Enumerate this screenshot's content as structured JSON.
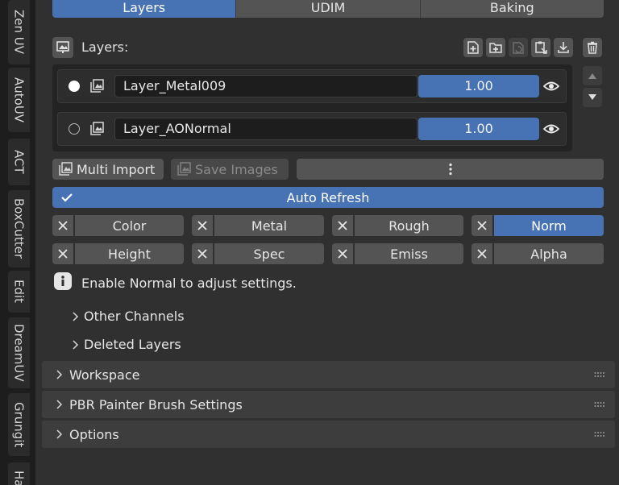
{
  "sidebar_tabs": [
    "Zen UV",
    "AutoUV",
    "ACT",
    "BoxCutter",
    "Edit",
    "DreamUV",
    "Grungit",
    "Ha"
  ],
  "mode_tabs": [
    {
      "label": "Layers",
      "active": true
    },
    {
      "label": "UDIM",
      "active": false
    },
    {
      "label": "Baking",
      "active": false
    }
  ],
  "layers_header": {
    "title": "Layers:",
    "icon": "image-icon"
  },
  "toolbar_icons": [
    "new-layer-icon",
    "new-folder-layer-icon",
    "refresh-layer-icon",
    "paste-layer-icon",
    "download-icon",
    "trash-icon"
  ],
  "layers": [
    {
      "name": "Layer_Metal009",
      "opacity": "1.00",
      "selected": true
    },
    {
      "name": "Layer_AONormal",
      "opacity": "1.00",
      "selected": false
    }
  ],
  "actions": {
    "multi_import": "Multi Import",
    "save_images": "Save Images"
  },
  "auto_refresh": "Auto Refresh",
  "channels": [
    {
      "label": "Color",
      "active": false
    },
    {
      "label": "Metal",
      "active": false
    },
    {
      "label": "Rough",
      "active": false
    },
    {
      "label": "Norm",
      "active": true
    },
    {
      "label": "Height",
      "active": false
    },
    {
      "label": "Spec",
      "active": false
    },
    {
      "label": "Emiss",
      "active": false
    },
    {
      "label": "Alpha",
      "active": false
    }
  ],
  "info_message": "Enable Normal to adjust settings.",
  "subsections": [
    "Other Channels",
    "Deleted Layers"
  ],
  "panels": [
    "Workspace",
    "PBR Painter Brush Settings",
    "Options"
  ],
  "colors": {
    "accent": "#4772b3",
    "background": "#303030",
    "button": "#545454"
  }
}
